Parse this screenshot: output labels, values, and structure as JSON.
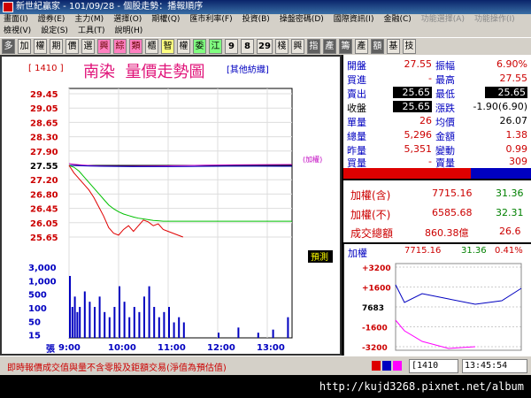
{
  "window": {
    "title": "新世紀贏家 - 101/09/28 - 個股走勢：播報順序"
  },
  "menu": {
    "row1": [
      "畫面(I)",
      "證券(E)",
      "主力(M)",
      "選擇(O)",
      "期權(Q)",
      "匯市利率(F)",
      "投資(B)",
      "操盤密碼(D)",
      "國際資訊(I)",
      "金融(C)",
      "功能選擇(A)",
      "功能操作(I)"
    ],
    "row2": [
      "檢視(V)",
      "設定(S)",
      "工具(T)",
      "說明(H)"
    ]
  },
  "toolbar": {
    "buttons": [
      "多",
      "加",
      "權",
      "期",
      "價",
      "選",
      "興",
      "綜",
      "類",
      "櫃",
      "智",
      "權",
      "委",
      "江",
      "9",
      "8",
      "29",
      "棧",
      "興",
      "指",
      "產",
      "籌",
      "產",
      "額",
      "基",
      "技"
    ]
  },
  "chart": {
    "code": "[ 1410 ]",
    "name": "南染",
    "title": "量價走勢圖",
    "sector": "[其他紡織]",
    "price_labels": [
      "29.45",
      "29.05",
      "28.65",
      "28.30",
      "27.90",
      "27.55",
      "27.20",
      "26.80",
      "26.45",
      "26.05",
      "25.65"
    ],
    "volume_labels": [
      "3,000",
      "1,000",
      "500",
      "100",
      "50",
      "15",
      "張"
    ],
    "time_labels": [
      "9:00",
      "10:00",
      "11:00",
      "12:00",
      "13:00"
    ],
    "index_tag": "(加權)",
    "estimate_tag": "預測"
  },
  "chart_data": {
    "type": "line",
    "price": {
      "ylim": [
        25.65,
        29.45
      ],
      "reference": 27.55,
      "x_hours": [
        9.0,
        9.1,
        9.2,
        9.3,
        9.4,
        9.5,
        9.6,
        9.7,
        9.8,
        9.9,
        10.0,
        10.1,
        10.2,
        10.3,
        10.4,
        10.5,
        10.6,
        10.7,
        10.8,
        10.9,
        11.0,
        11.1,
        11.2,
        11.3
      ],
      "values": [
        27.55,
        27.35,
        27.2,
        27.05,
        26.9,
        26.7,
        26.45,
        26.2,
        25.9,
        25.75,
        25.7,
        25.85,
        25.95,
        25.8,
        25.95,
        26.1,
        26.05,
        25.95,
        26.0,
        25.85,
        25.8,
        25.75,
        25.7,
        25.65
      ],
      "avg_values": [
        27.55,
        27.5,
        27.4,
        27.25,
        27.1,
        26.95,
        26.8,
        26.65,
        26.5,
        26.4,
        26.32,
        26.26,
        26.22,
        26.18,
        26.15,
        26.13,
        26.11,
        26.09,
        26.08,
        26.07,
        26.07,
        26.07,
        26.07,
        26.07
      ]
    },
    "volume": {
      "x_hours": [
        9.0,
        9.05,
        9.1,
        9.15,
        9.2,
        9.3,
        9.4,
        9.5,
        9.6,
        9.7,
        9.8,
        9.9,
        10.0,
        10.1,
        10.2,
        10.3,
        10.4,
        10.5,
        10.6,
        10.7,
        10.8,
        10.9,
        11.0,
        11.1,
        11.2,
        11.3,
        12.0,
        12.4,
        12.8,
        13.1,
        13.4
      ],
      "values": [
        60,
        30,
        40,
        25,
        30,
        45,
        35,
        30,
        40,
        25,
        20,
        30,
        50,
        35,
        20,
        30,
        25,
        40,
        50,
        30,
        20,
        25,
        30,
        15,
        20,
        15,
        5,
        10,
        5,
        8,
        20
      ]
    }
  },
  "quote": {
    "open_label": "開盤",
    "open": "27.55",
    "amp_label": "振幅",
    "amp": "6.90%",
    "bid_label": "買進",
    "bid": "-",
    "high_label": "最高",
    "high": "27.55",
    "ask_label": "賣出",
    "ask": "25.65",
    "low_label": "最低",
    "low": "25.65",
    "close_label": "收盤",
    "close": "25.65",
    "change_label": "漲跌",
    "change": "-1.90(6.90)",
    "lot_label": "單量",
    "lot": "26",
    "avg_label": "均價",
    "avg": "26.07",
    "total_label": "總量",
    "total": "5,296",
    "amount_label": "金額",
    "amount": "1.38",
    "prev_label": "昨量",
    "prev": "5,351",
    "vary_label": "變動",
    "vary": "0.99",
    "buyvol_label": "買量",
    "buyvol": "-",
    "sellvol_label": "賣量",
    "sellvol": "309"
  },
  "index": {
    "incl_label": "加權(含)",
    "incl": "7715.16",
    "incl_chg": "31.36",
    "excl_label": "加權(不)",
    "excl": "6585.68",
    "excl_chg": "32.31",
    "turnover_label": "成交總額",
    "turnover": "860.38億",
    "turnover_chg": "26.6"
  },
  "mini": {
    "label": "加權",
    "value": "7715.16",
    "change": "31.36",
    "pct": "0.41%",
    "ticks": [
      "+3200",
      "+1600",
      "7683",
      "-1600",
      "-3200"
    ]
  },
  "status": {
    "note": "即時報價成交值與量不含零股及鉅額交易(淨值為預估值)",
    "code": "[1410",
    "time": "13:45:54"
  },
  "watermark": "http://kujd3268.pixnet.net/album",
  "colors": {
    "accent_red": "#e00000",
    "accent_blue": "#0000c0",
    "magenta": "#e0147a",
    "bg_gray": "#d4d0c8"
  }
}
